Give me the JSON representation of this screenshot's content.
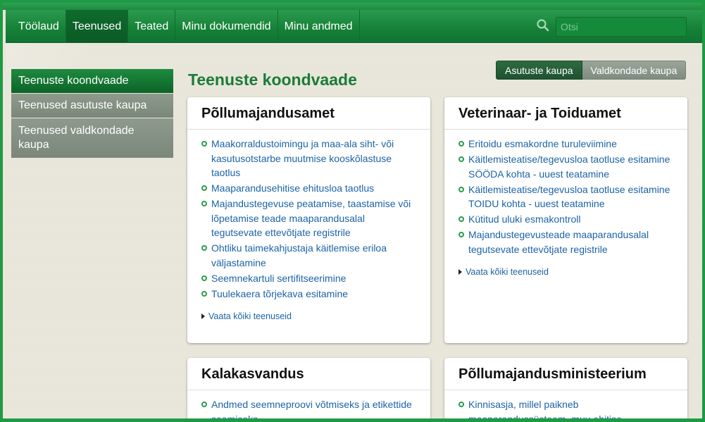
{
  "nav": {
    "items": [
      {
        "label": "Töölaud",
        "active": false
      },
      {
        "label": "Teenused",
        "active": true
      },
      {
        "label": "Teated",
        "active": false
      },
      {
        "label": "Minu dokumendid",
        "active": false
      },
      {
        "label": "Minu andmed",
        "active": false
      }
    ],
    "search_placeholder": "Otsi"
  },
  "sidebar": {
    "items": [
      {
        "label": "Teenuste koondvaade",
        "active": true
      },
      {
        "label": "Teenused asutuste kaupa",
        "active": false
      },
      {
        "label": "Teenused valdkondade kaupa",
        "active": false
      }
    ]
  },
  "view_toggle": {
    "by_institution": "Asutuste kaupa",
    "by_field": "Valdkondade kaupa",
    "selected": "Asutuste kaupa"
  },
  "page_title": "Teenuste koondvaade",
  "cards": [
    {
      "title": "Põllumajandusamet",
      "services": [
        "Maakorraldustoimingu ja maa-ala siht- või kasutusotstarbe muutmise kooskõlastuse taotlus",
        "Maaparandusehitise ehitusloa taotlus",
        "Majandustegevuse peatamise, taastamise või lõpetamise teade maaparandusalal tegutsevate ettevõtjate registrile",
        "Ohtliku taimekahjustaja käitlemise eriloa väljastamine",
        "Seemnekartuli sertifitseerimine",
        "Tuulekaera tõrjekava esitamine"
      ],
      "see_all": "Vaata kõiki teenuseid"
    },
    {
      "title": "Veterinaar- ja Toiduamet",
      "services": [
        "Eritoidu esmakordne turuleviimine",
        "Käitlemisteatise/tegevusloa taotluse esitamine SÖÖDA kohta - uuest teatamine",
        "Käitlemisteatise/tegevusloa taotluse esitamine TOIDU kohta - uuest teatamine",
        "Kütitud uluki esmakontroll",
        "Majandustegevusteade maaparandusalal tegutsevate ettevõtjate registrile"
      ],
      "see_all": "Vaata kõiki teenuseid"
    },
    {
      "title": "Kalakasvandus",
      "services": [
        "Andmed seemneproovi võtmiseks ja etikettide saamiseks"
      ],
      "see_all": ""
    },
    {
      "title": "Põllumajandusministeerium",
      "services": [
        "Kinnisasja, millel paikneb maaparandussüsteem, muu ehitise"
      ],
      "see_all": ""
    }
  ],
  "colors": {
    "brand_green": "#168238",
    "title_green": "#1b7b3a",
    "link_blue": "#1c63a6",
    "sidebar_gray": "#7a877a"
  }
}
